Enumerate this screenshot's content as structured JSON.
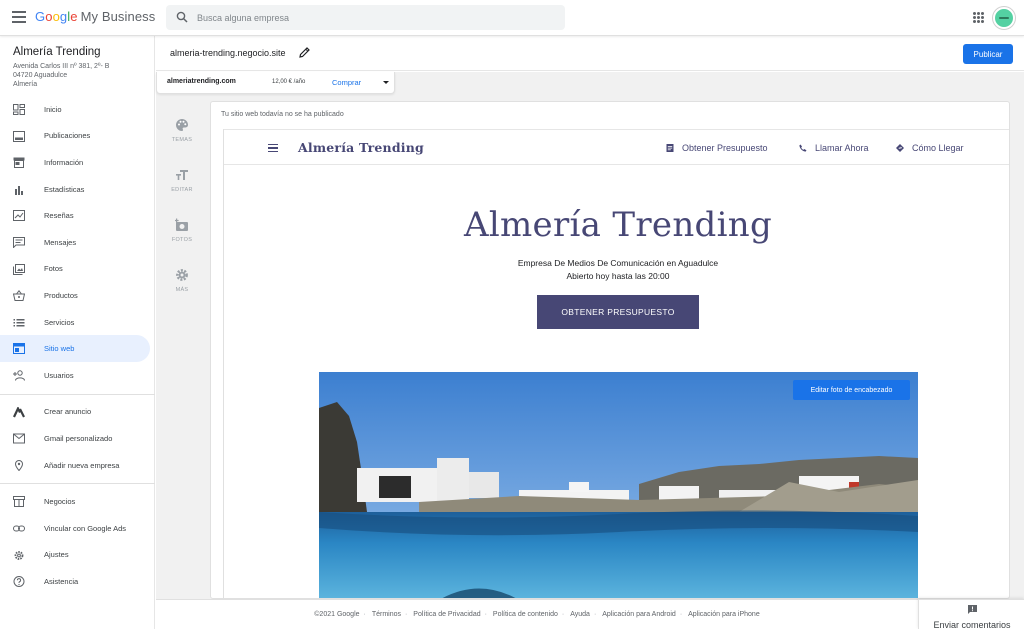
{
  "app": {
    "logo_google": [
      "G",
      "o",
      "o",
      "g",
      "l",
      "e"
    ],
    "logo_product": "My Business",
    "search_placeholder": "Busca alguna empresa"
  },
  "business": {
    "name": "Almería Trending",
    "address_line1": "Avenida Carlos III nº 381, 2º- B",
    "address_line2": "04720 Aguadulce",
    "address_line3": "Almería"
  },
  "sidebar": {
    "items": [
      {
        "label": "Inicio",
        "icon": "home-dashboard-icon"
      },
      {
        "label": "Publicaciones",
        "icon": "posts-icon"
      },
      {
        "label": "Información",
        "icon": "storefront-icon"
      },
      {
        "label": "Estadísticas",
        "icon": "bar-chart-icon"
      },
      {
        "label": "Reseñas",
        "icon": "reviews-icon"
      },
      {
        "label": "Mensajes",
        "icon": "message-icon"
      },
      {
        "label": "Fotos",
        "icon": "photos-icon"
      },
      {
        "label": "Productos",
        "icon": "basket-icon"
      },
      {
        "label": "Servicios",
        "icon": "list-icon"
      },
      {
        "label": "Sitio web",
        "icon": "website-icon",
        "active": true
      },
      {
        "label": "Usuarios",
        "icon": "add-user-icon"
      }
    ],
    "extra_items": [
      {
        "label": "Crear anuncio",
        "icon": "google-ads-icon"
      },
      {
        "label": "Gmail personalizado",
        "icon": "gmail-icon"
      },
      {
        "label": "Añadir nueva empresa",
        "icon": "location-pin-icon"
      }
    ],
    "bottom_items": [
      {
        "label": "Negocios",
        "icon": "businesses-icon"
      },
      {
        "label": "Vincular con Google Ads",
        "icon": "link-icon"
      },
      {
        "label": "Ajustes",
        "icon": "settings-gear-icon"
      },
      {
        "label": "Asistencia",
        "icon": "help-icon"
      }
    ]
  },
  "subheader": {
    "site_url": "almeria-trending.negocio.site",
    "publish_label": "Publicar"
  },
  "domain_bar": {
    "domain": "almeriatrending.com",
    "price": "12,00 € /año",
    "buy_label": "Comprar"
  },
  "tools": [
    {
      "label": "TEMAS",
      "icon": "palette-icon"
    },
    {
      "label": "EDITAR",
      "icon": "text-edit-icon"
    },
    {
      "label": "FOTOS",
      "icon": "add-photo-icon"
    },
    {
      "label": "MÁS",
      "icon": "settings-gear-icon"
    }
  ],
  "preview": {
    "not_published": "Tu sitio web todavía no se ha publicado",
    "brand": "Almería Trending",
    "nav_links": [
      {
        "label": "Obtener Presupuesto",
        "icon": "quote-doc-icon"
      },
      {
        "label": "Llamar Ahora",
        "icon": "phone-icon"
      },
      {
        "label": "Cómo Llegar",
        "icon": "directions-icon"
      }
    ],
    "hero_title": "Almería Trending",
    "hero_subtitle": "Empresa De Medios De Comunicación en Aguadulce",
    "hero_hours": "Abierto hoy hasta las 20:00",
    "cta_label": "OBTENER PRESUPUESTO",
    "edit_photo_label": "Editar foto de encabezado"
  },
  "footer": {
    "links": [
      "©2021 Google",
      "Términos",
      "Política de Privacidad",
      "Política de contenido",
      "Ayuda",
      "Aplicación para Android",
      "Aplicación para iPhone"
    ],
    "feedback_label": "Enviar comentarios"
  },
  "colors": {
    "accent": "#1a73e8",
    "site_primary": "#474775",
    "active_bg": "#e8f0fe"
  }
}
